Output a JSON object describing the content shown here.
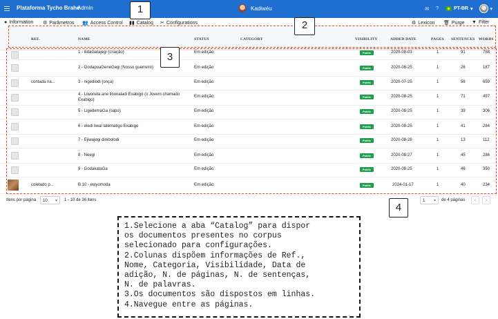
{
  "topbar": {
    "brand": "Plataforma Tycho Brahe",
    "role": "Admin",
    "user": "Kadiwéu",
    "lang": "PT-BR",
    "accent": "#1f6fd1"
  },
  "tabs": {
    "information": "Information",
    "parametros": "Parâmetros",
    "access": "Access Control",
    "catalog": "Catalog",
    "configurations": "Configurations",
    "lexicon": "Lexicon",
    "purge": "Purge",
    "filter": "Filter"
  },
  "columns": {
    "ref": "REF.",
    "name": "NAME",
    "status": "STATUS",
    "category": "CATEGORY",
    "visibility": "VISIBILITY",
    "added_date": "ADDED DATE",
    "pages": "PAGES",
    "sentences": "SENTENCES",
    "words": "WORDS"
  },
  "rows": [
    {
      "ref": "",
      "name": "1 - ilidaGatajegi (criação)",
      "status": "Em edição",
      "category": "",
      "visibility": "Public",
      "date": "2020-08-03",
      "pages": "1",
      "sentences": "91",
      "words": "758"
    },
    {
      "ref": "",
      "name": "2 - GodapoaGeneGegi (Nosso guerreiro)",
      "status": "Em edição",
      "category": "",
      "visibility": "Public",
      "date": "2020-08-25",
      "pages": "1",
      "sentences": "26",
      "words": "187"
    },
    {
      "ref": "contada na...",
      "name": "3 - nigediodi (onça)",
      "status": "Em edição",
      "category": "",
      "visibility": "Public",
      "date": "2020-07-25",
      "pages": "1",
      "sentences": "56",
      "words": "659"
    },
    {
      "ref": "",
      "name": "4 - Liwonela ane libonaladi Exabigo (o Jovem chamado Exabigo)",
      "status": "Em edição",
      "category": "",
      "visibility": "Public",
      "date": "2020-08-25",
      "pages": "1",
      "sentences": "71",
      "words": "497"
    },
    {
      "ref": "",
      "name": "5 - LigedemaGa (sapo)",
      "status": "Em edição",
      "category": "",
      "visibility": "Public",
      "date": "2020-08-25",
      "pages": "1",
      "sentences": "39",
      "words": "306"
    },
    {
      "ref": "",
      "name": "6 - eledi liwal latematigo Exabigo",
      "status": "Em edição",
      "category": "",
      "visibility": "Public",
      "date": "2020-08-25",
      "pages": "1",
      "sentences": "41",
      "words": "284"
    },
    {
      "ref": "",
      "name": "7 - Ejiwajegi dinibolodi",
      "status": "Em edição",
      "category": "",
      "visibility": "Public",
      "date": "2020-08-28",
      "pages": "1",
      "sentences": "13",
      "words": "112"
    },
    {
      "ref": "",
      "name": "8 - Neegi",
      "status": "Em edição",
      "category": "",
      "visibility": "Public",
      "date": "2020-08-27",
      "pages": "1",
      "sentences": "45",
      "words": "286"
    },
    {
      "ref": "",
      "name": "9 - GodakataGa",
      "status": "Em edição",
      "category": "",
      "visibility": "Public",
      "date": "2020-08-25",
      "pages": "1",
      "sentences": "46",
      "words": "350"
    },
    {
      "ref": "coletado p...",
      "name": "B.10 - ewyomoda",
      "status": "Em edição",
      "category": "",
      "visibility": "Public",
      "date": "2024-01-17",
      "pages": "1",
      "sentences": "40",
      "words": "234"
    }
  ],
  "footer": {
    "per_page_label": "Itens por página",
    "per_page_value": "10",
    "range": "1 - 10 de 36 itens",
    "page_value": "1",
    "of_pages": "de 4 páginas",
    "prev": "‹",
    "next": "›"
  },
  "annotations": {
    "n1": "1",
    "n2": "2",
    "n3": "3",
    "n4": "4",
    "note": "1.Selecione a aba “Catalog” para dispor\nos documentos presentes no corpus\nselecionado para configurações.\n2.Colunas dispõem informações de Ref.,\nNome, Categoria, Visibilidade, Data de\nadição, N. de páginas, N. de sentenças,\nN. de palavras.\n3.Os documentos são dispostos em linhas.\n4.Navegue entre as páginas."
  }
}
